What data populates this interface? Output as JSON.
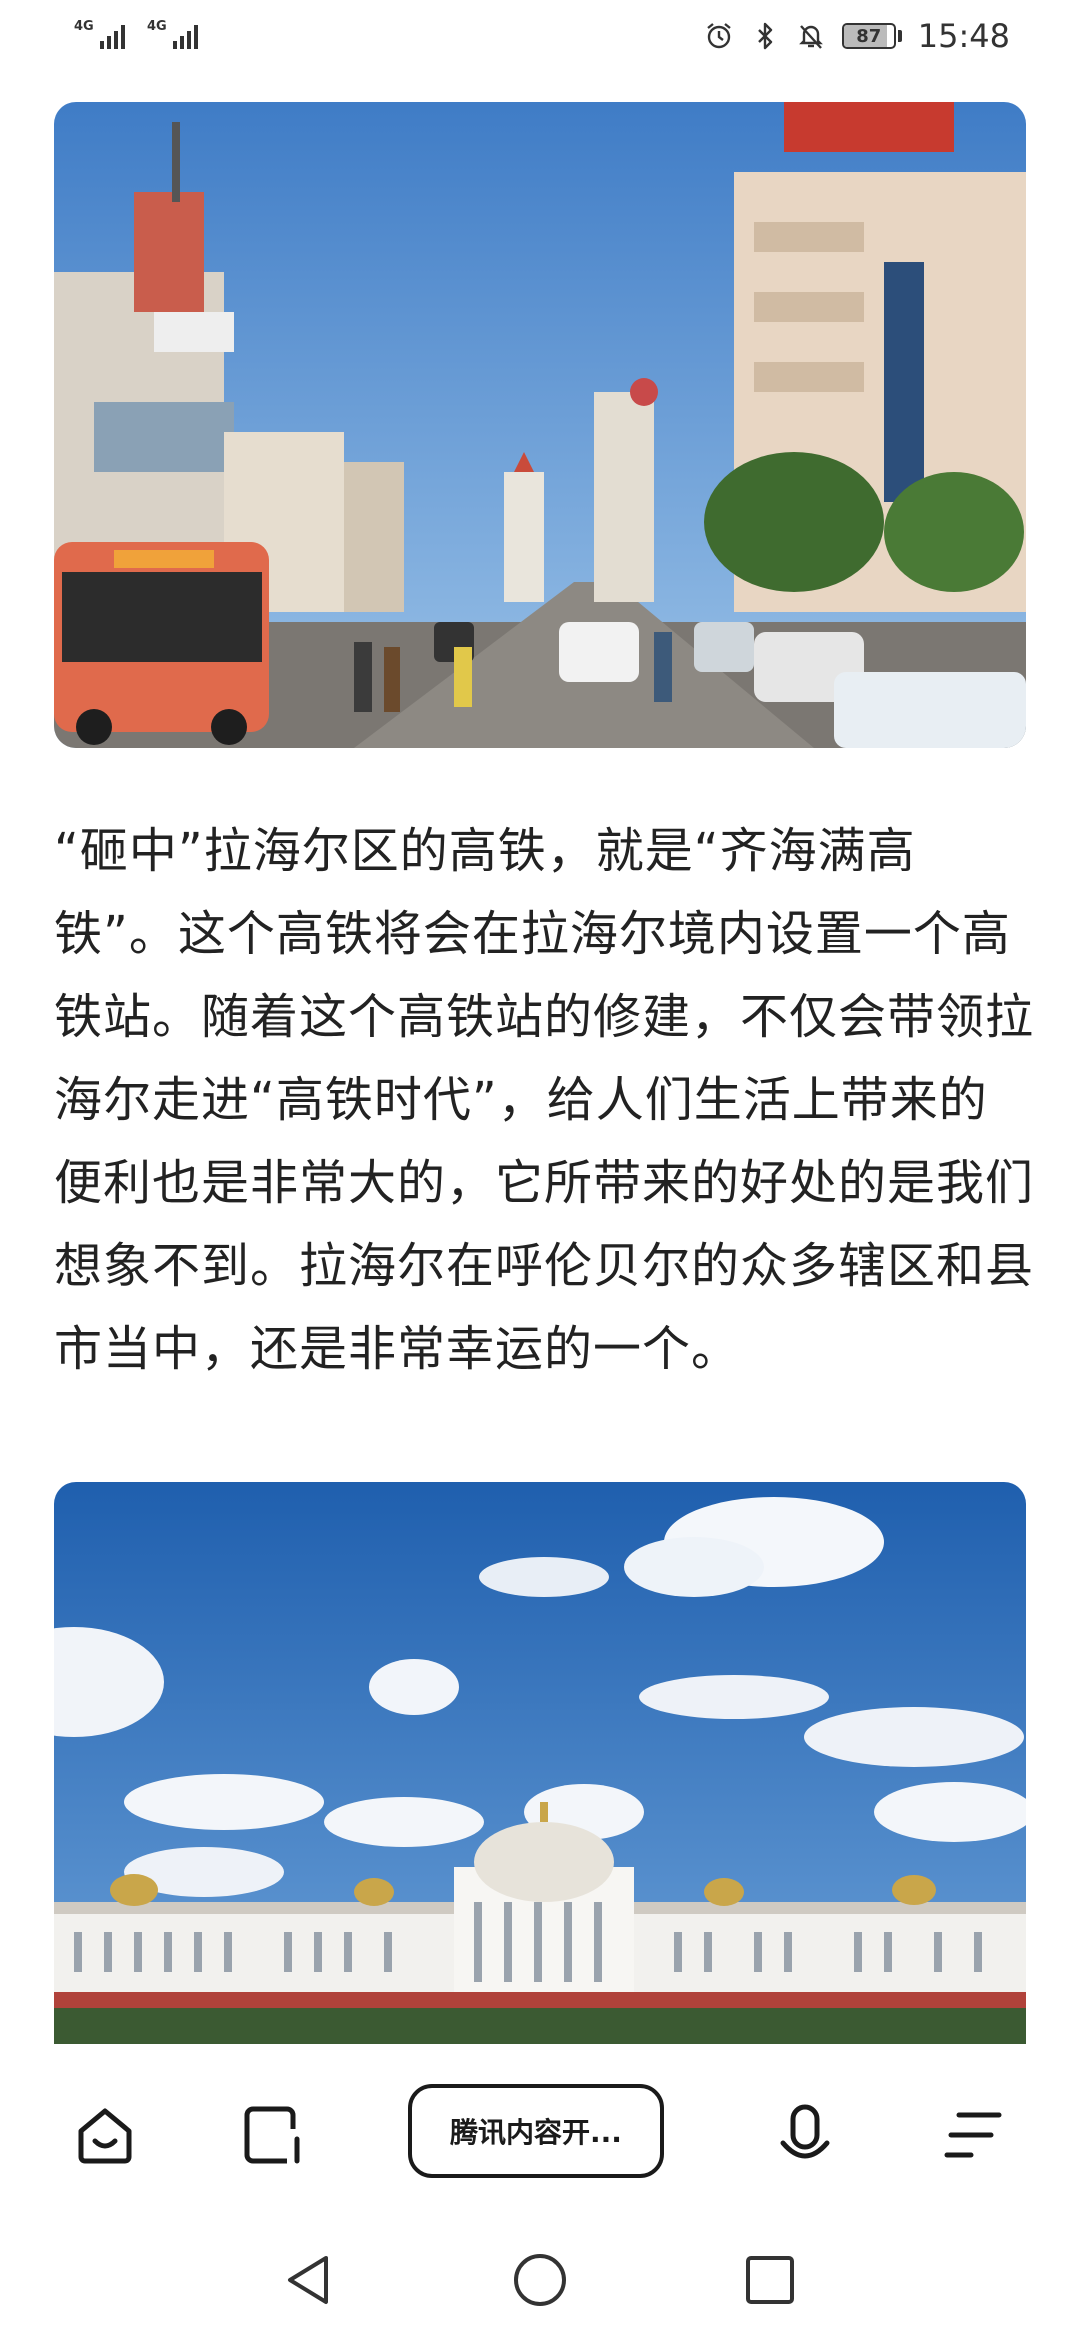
{
  "status_bar": {
    "network_1": "4G",
    "network_2": "4G",
    "battery_level": 87,
    "battery_text": "87",
    "time": "15:48"
  },
  "images": {
    "top_photo_icon": "city-street-photo",
    "bottom_photo_icon": "government-building-photo"
  },
  "article": {
    "paragraph": "“砸中”拉海尔区的高铁，就是“齐海满高铁”。这个高铁将会在拉海尔境内设置一个高铁站。随着这个高铁站的修建，不仅会带领拉海尔走进“高铁时代”，给人们生活上带来的便利也是非常大的，它所带来的好处的是我们想象不到。拉海尔在呼伦贝尔的众多辖区和县市当中，还是非常幸运的一个。"
  },
  "toolbar": {
    "center_label": "腾讯内容开...",
    "icons": [
      "home-icon",
      "tabs-icon",
      "voice-icon",
      "menu-icon"
    ]
  },
  "navbar": {
    "icons": [
      "back-icon",
      "home-circle-icon",
      "recents-icon"
    ]
  },
  "colors": {
    "text": "#222222",
    "toolbar_border": "#1a1a1a"
  }
}
